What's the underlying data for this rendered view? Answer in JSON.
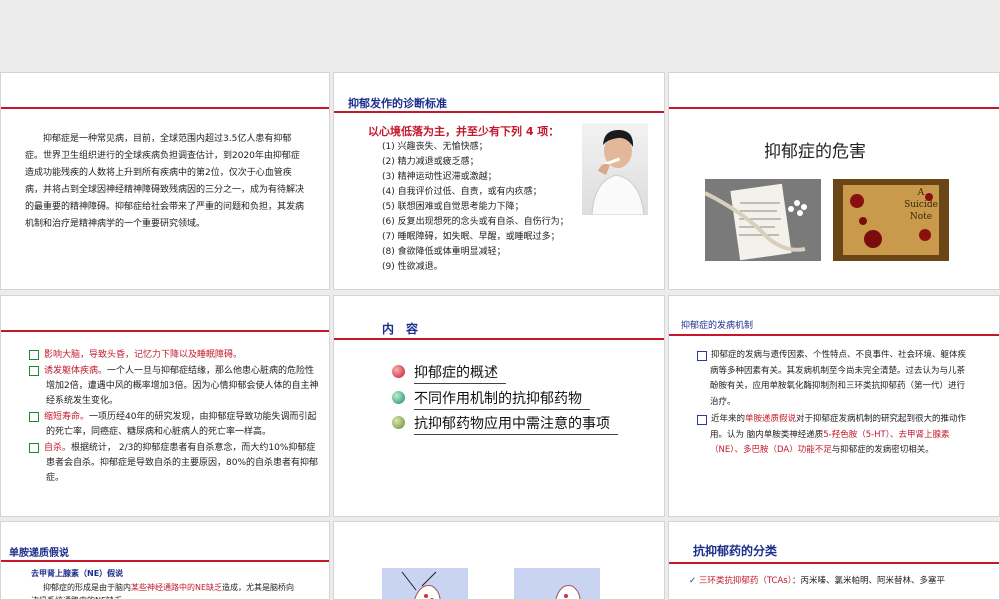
{
  "colors": {
    "accent_red": "#c3192b",
    "title_blue": "#1d2f8c",
    "bullet_green": "#1f8a2e"
  },
  "slide1": {
    "paragraph": "抑郁症是一种常见病，目前，全球范围内超过3.5亿人患有抑郁症。世界卫生组织进行的全球疾病负担调查估计，到2020年由抑郁症造成功能残疾的人数将上升到所有疾病中的第2位，仅次于心血管疾病，并将占到全球因神经精神障碍致残病因的三分之一，成为有待解决的最重要的精神障碍。抑郁症给社会带来了严重的问题和负担，其发病机制和治疗是精神病学的一个重要研究领域。"
  },
  "slide2": {
    "title": "抑郁发作的诊断标准",
    "heading": "以心境低落为主，并至少有下列 4 项：",
    "criteria": [
      "(1) 兴趣丧失、无愉快感；",
      "(2) 精力减退或疲乏感；",
      "(3) 精神运动性迟滞或激越；",
      "(4) 自我评价过低、自责，或有内疚感；",
      "(5) 联想困难或自觉思考能力下降；",
      "(6) 反复出现想死的念头或有自杀、自伤行为；",
      "(7) 睡眠障碍，如失眠、早醒，或睡眠过多；",
      "(8) 食欲降低或体重明显减轻；",
      "(9) 性欲减退。"
    ],
    "photo_icon": "man-smoking-photo"
  },
  "slide3": {
    "title": "抑郁症的危害",
    "image_left_icon": "noose-note-photo",
    "image_right_text": [
      "A",
      "Suicide",
      "Note"
    ]
  },
  "slide4": {
    "items": [
      {
        "lead": "影响大脑，导致头昏，记忆力下降以及睡眠障碍。",
        "rest": ""
      },
      {
        "lead": "诱发躯体疾病。",
        "rest": "一个人一旦与抑郁症结缘，那么他患心脏病的危险性增加2倍，遭遇中风的概率增加3倍。因为心情抑郁会使人体的自主神经系统发生变化。"
      },
      {
        "lead": "缩短寿命。",
        "rest": "一项历经40年的研究发现，由抑郁症导致功能失调而引起的死亡率，同癌症、糖尿病和心脏病人的死亡率一样高。"
      },
      {
        "lead": "自杀。",
        "rest": "根据统计， 2/3的抑郁症患者有自杀意念，而大约10%抑郁症患者会自杀。抑郁症是导致自杀的主要原因，80%的自杀患者有抑郁症。"
      }
    ]
  },
  "slide5": {
    "title": "内　容",
    "items": [
      "抑郁症的概述",
      "不同作用机制的抗抑郁药物",
      "抗抑郁药物应用中需注意的事项"
    ]
  },
  "slide6": {
    "title": "抑郁症的发病机制",
    "p1": "抑郁症的发病与遗传因素、个性特点、不良事件、社会环境、躯体疾病等多种因素有关。其发病机制至今尚未完全清楚。过去认为与儿茶酚胺有关，应用单胺氧化酶抑制剂和三环类抗抑郁药（第一代）进行治疗。",
    "p2_a": "近年来的",
    "p2_red1": "单胺递质假说",
    "p2_b": "对于抑郁症发病机制的研究起到很大的推动作用。认为 脑内单胺类神经递质",
    "p2_red2": "5-羟色胺（5-HT）、去甲肾上腺素（NE）、多巴胺（DA）功能不足",
    "p2_c": "与抑郁症的发病密切相关。"
  },
  "slide7": {
    "title": "单胺递质假说",
    "sub": "去甲肾上腺素（NE）假说",
    "p_a": "抑郁症的形成是由于脑内",
    "p_red": "某些神经通路中的NE缺乏",
    "p_b": "造成，尤其是脑桥向边缘系统通路中的NE缺乏。"
  },
  "slide8": {
    "figure_icon": "synapse-diagram"
  },
  "slide9": {
    "title": "抗抑郁药的分类",
    "item_red": "三环类抗抑郁药（TCAs）",
    "item_rest": "：丙米嗪、氯米帕明、阿米替林、多塞平"
  }
}
